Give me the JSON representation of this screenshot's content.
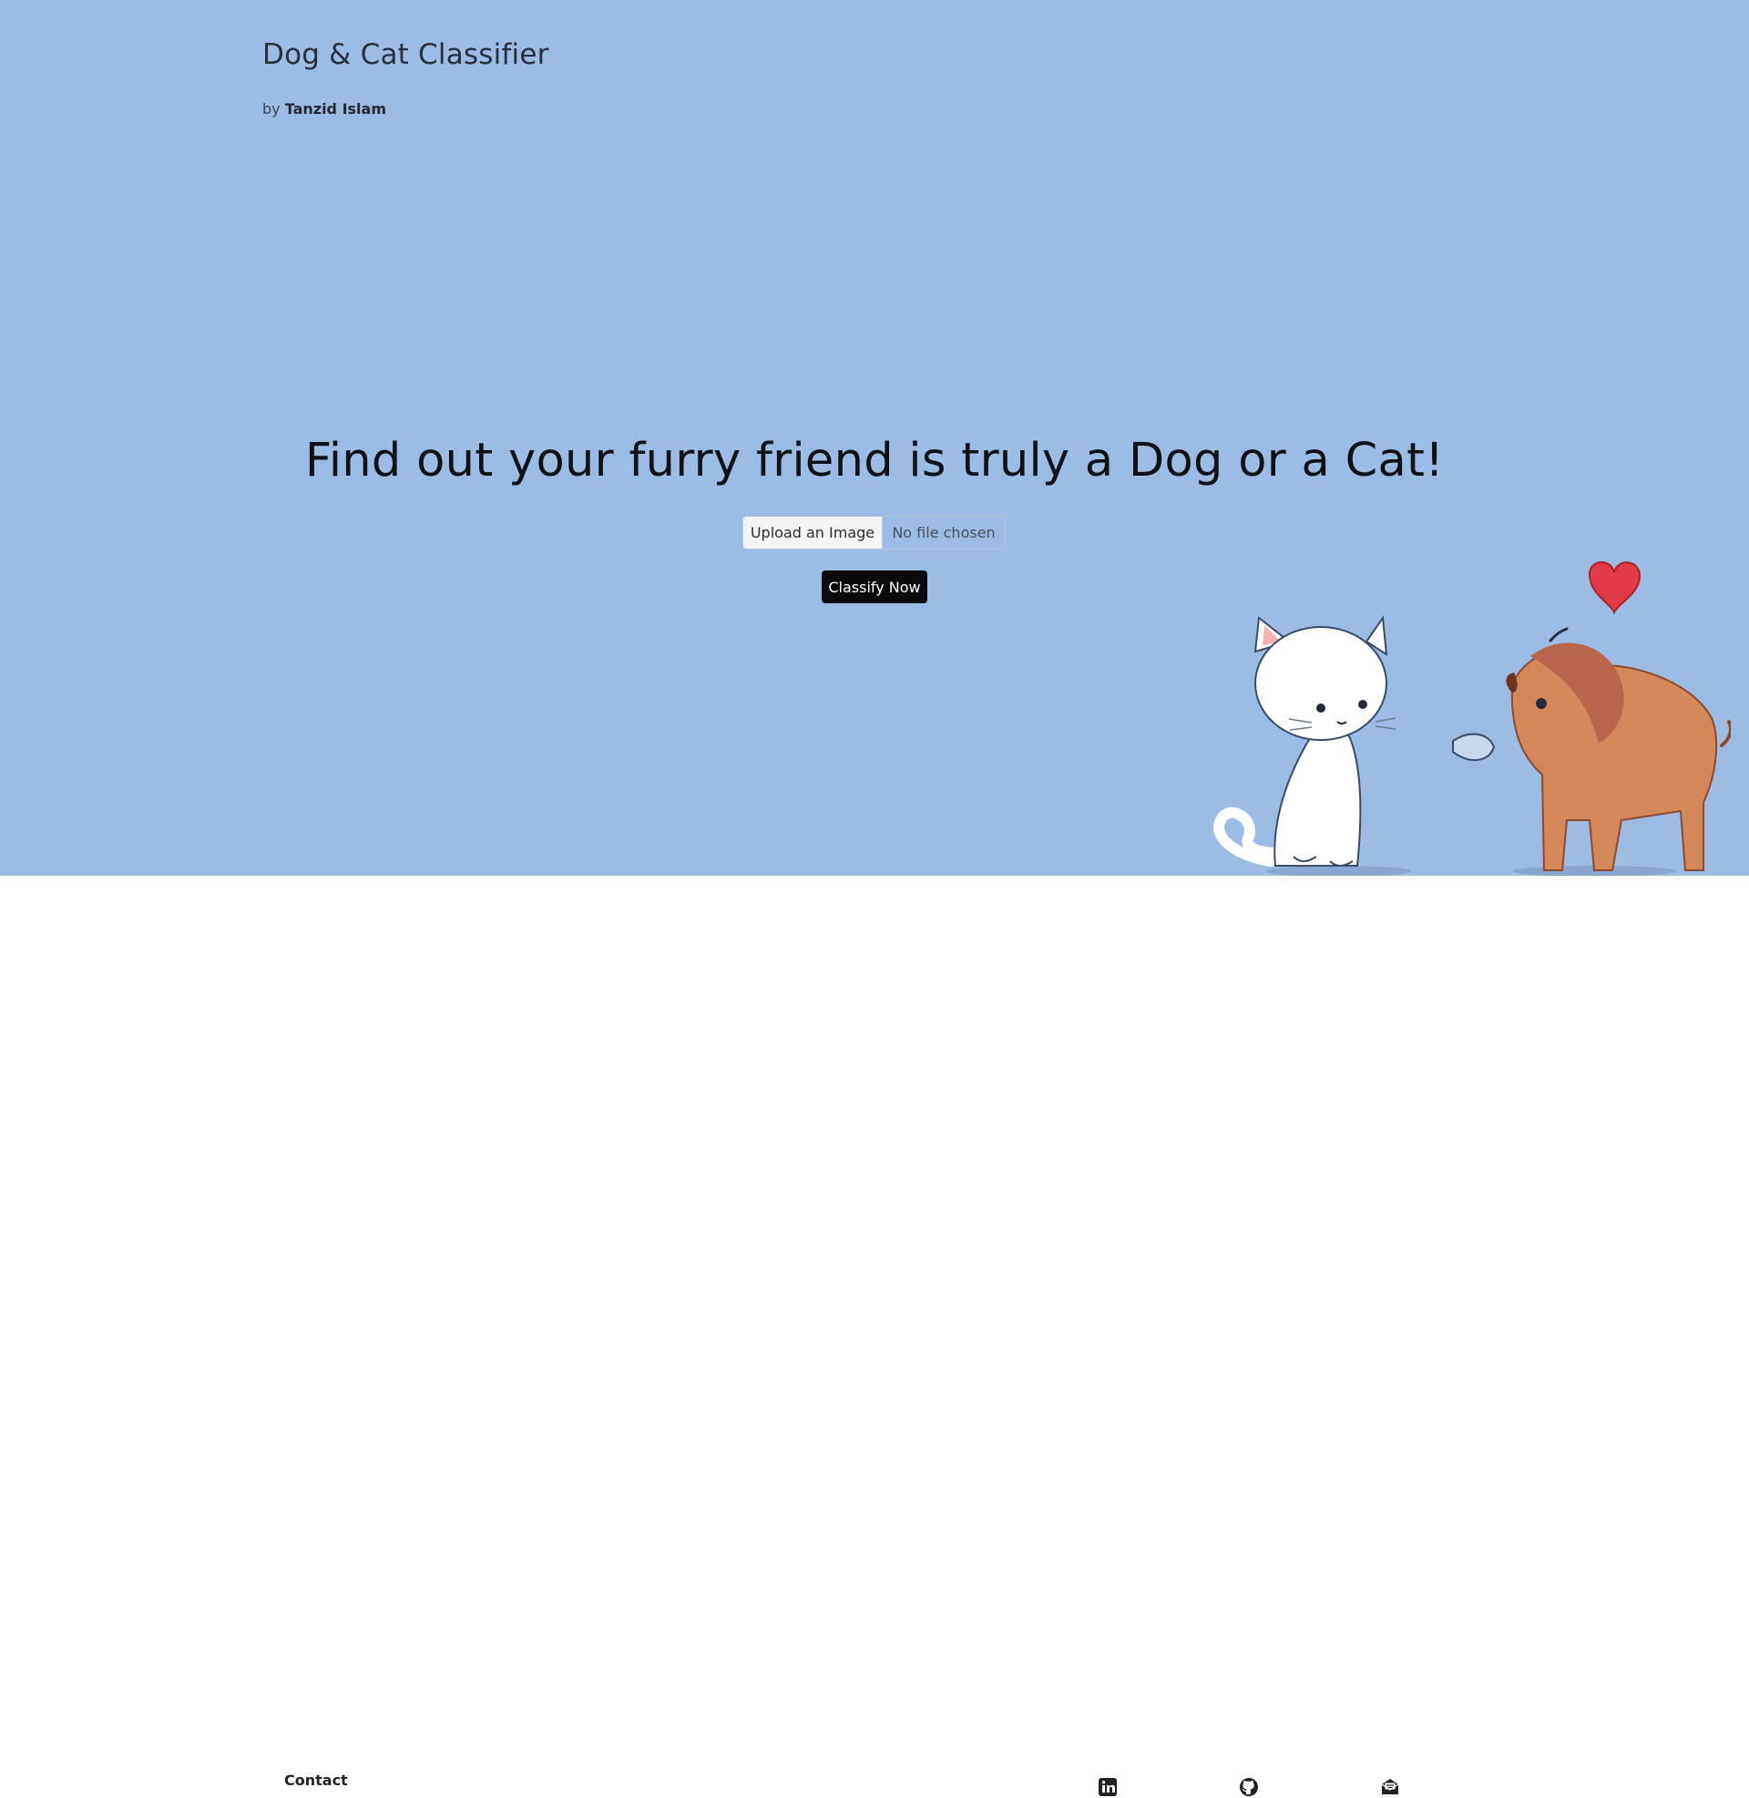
{
  "header": {
    "title": "Dog & Cat Classifier",
    "by_prefix": "by",
    "author": "Tanzid Islam"
  },
  "main": {
    "headline": "Find out your furry friend is truly a Dog or a Cat!",
    "upload_button_label": "Upload an Image",
    "file_status": "No file chosen",
    "classify_button_label": "Classify Now"
  },
  "footer": {
    "contact_label": "Contact",
    "social_icons": [
      "linkedin-icon",
      "github-icon",
      "mail-icon"
    ]
  },
  "colors": {
    "hero_background": "#9dbce4",
    "footer_background": "#ffffff",
    "primary_button": "#0b0b0c",
    "heart": "#e23b45"
  }
}
